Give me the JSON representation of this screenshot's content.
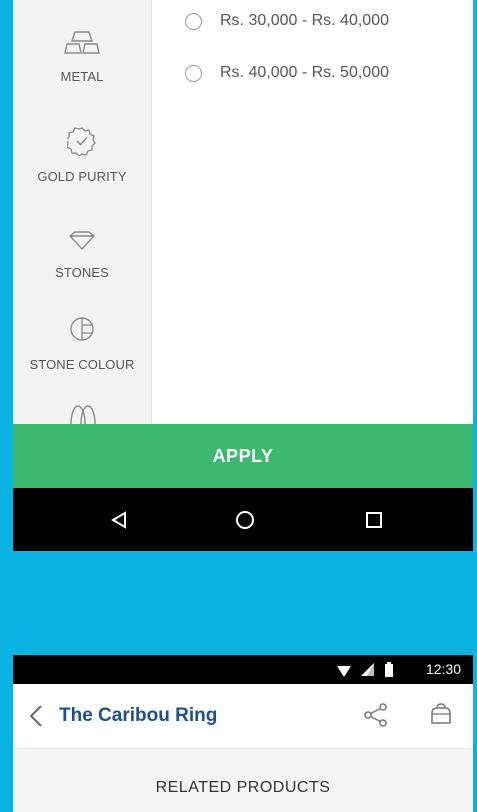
{
  "filter": {
    "categories": [
      {
        "label": "METAL",
        "icon": "metal-bars-icon"
      },
      {
        "label": "GOLD PURITY",
        "icon": "purity-badge-icon"
      },
      {
        "label": "STONES",
        "icon": "diamond-icon"
      },
      {
        "label": "STONE COLOUR",
        "icon": "color-wheel-icon"
      },
      {
        "label": "",
        "icon": "gender-icon"
      }
    ],
    "price_options": [
      {
        "label": "Rs. 30,000 - Rs. 40,000",
        "selected": false
      },
      {
        "label": "Rs. 40,000 - Rs. 50,000",
        "selected": false
      }
    ],
    "apply_label": "APPLY"
  },
  "nav": {
    "back_icon": "triangle-back-icon",
    "home_icon": "circle-home-icon",
    "recents_icon": "square-recents-icon"
  },
  "status": {
    "time": "12:30"
  },
  "product": {
    "title": "The Caribou Ring",
    "section_title": "RELATED PRODUCTS"
  },
  "colors": {
    "background": "#0bb3e3",
    "apply_button": "#3cb86f",
    "title": "#1d4f8c"
  }
}
